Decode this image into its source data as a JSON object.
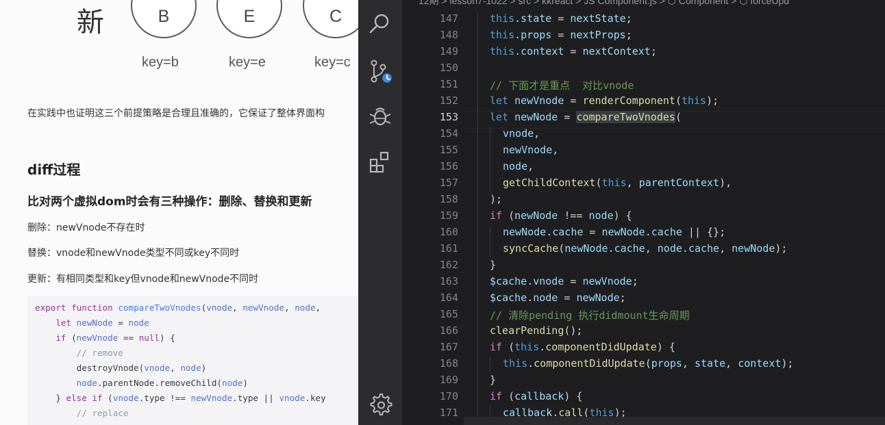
{
  "doc": {
    "new_char": "新",
    "nodes": [
      {
        "letter": "B",
        "key": "key=b"
      },
      {
        "letter": "E",
        "key": "key=e"
      },
      {
        "letter": "C",
        "key": "key=c"
      }
    ],
    "paragraph": "在实践中也证明这三个前提策略是合理且准确的，它保证了整体界面构",
    "heading": "diff过程",
    "subheading": "比对两个虚拟dom时会有三种操作：删除、替换和更新",
    "items": [
      "删除：newVnode不存在时",
      "替换：vnode和newVnode类型不同或key不同时",
      "更新：有相同类型和key但vnode和newVnode不同时"
    ],
    "code": {
      "l1a": "export",
      "l1b": " function ",
      "l1c": "compareTwoVnodes",
      "l1d": "(",
      "l1e": "vnode",
      "l1f": ", ",
      "l1g": "newVnode",
      "l1h": ", ",
      "l1i": "node",
      "l1j": ", ",
      "l2a": "    let ",
      "l2b": "newNode",
      "l2c": " = ",
      "l2d": "node",
      "l3a": "    if ",
      "l3b": "(",
      "l3c": "newVnode",
      "l3d": " == ",
      "l3e": "null",
      "l3f": ") {",
      "l4": "        // remove",
      "l5a": "        destroyVnode(",
      "l5b": "vnode",
      "l5c": ", ",
      "l5d": "node",
      "l5e": ")",
      "l6a": "        ",
      "l6b": "node",
      "l6c": ".parentNode.removeChild(",
      "l6d": "node",
      "l6e": ")",
      "l7a": "    } ",
      "l7b": "else if ",
      "l7c": "(",
      "l7d": "vnode",
      "l7e": ".type !== ",
      "l7f": "newVnode",
      "l7g": ".type || ",
      "l7h": "vnode",
      "l7i": ".key",
      "l8": "        // replace"
    }
  },
  "editor": {
    "breadcrumb": "12期  >  lesson7-1022  >  src  >  kkreact  >  JS Component.js  >  ⬡ Component  >  ⬡ forceUpd",
    "lines": [
      {
        "n": "147",
        "t": [
          "this",
          ".state",
          " = ",
          "nextState",
          ";"
        ]
      },
      {
        "n": "148",
        "t": [
          "this",
          ".props",
          " = ",
          "nextProps",
          ";"
        ]
      },
      {
        "n": "149",
        "t": [
          "this",
          ".context",
          " = ",
          "nextContext",
          ";"
        ]
      },
      {
        "n": "150"
      },
      {
        "n": "151",
        "t": [
          "// 下面才是重点  对比vnode"
        ]
      },
      {
        "n": "152",
        "t": [
          "let ",
          "newVnode",
          " = ",
          "renderComponent",
          "(",
          "this",
          ");"
        ]
      },
      {
        "n": "153",
        "t": [
          "let ",
          "newNode",
          " = ",
          "compareTwoVnodes",
          "("
        ]
      },
      {
        "n": "154",
        "t": [
          "vnode",
          ","
        ]
      },
      {
        "n": "155",
        "t": [
          "newVnode",
          ","
        ]
      },
      {
        "n": "156",
        "t": [
          "node",
          ","
        ]
      },
      {
        "n": "157",
        "t": [
          "getChildContext",
          "(",
          "this",
          ", ",
          "parentContext",
          "),"
        ]
      },
      {
        "n": "158",
        "t": [
          ");"
        ]
      },
      {
        "n": "159",
        "t": [
          "if ",
          "(",
          "newNode",
          " !== ",
          "node",
          ") {"
        ]
      },
      {
        "n": "160",
        "t": [
          "newNode",
          ".",
          "cache",
          " = ",
          "newNode",
          ".",
          "cache",
          " || {};"
        ]
      },
      {
        "n": "161",
        "t": [
          "syncCache",
          "(",
          "newNode",
          ".",
          "cache",
          ", ",
          "node",
          ".",
          "cache",
          ", ",
          "newNode",
          ");"
        ]
      },
      {
        "n": "162",
        "t": [
          "}"
        ]
      },
      {
        "n": "163",
        "t": [
          "$cache",
          ".",
          "vnode",
          " = ",
          "newVnode",
          ";"
        ]
      },
      {
        "n": "164",
        "t": [
          "$cache",
          ".",
          "node",
          " = ",
          "newNode",
          ";"
        ]
      },
      {
        "n": "165",
        "t": [
          "// 清除pending 执行didmount生命周期"
        ]
      },
      {
        "n": "166",
        "t": [
          "clearPending",
          "();"
        ]
      },
      {
        "n": "167",
        "t": [
          "if ",
          "(",
          "this",
          ".",
          "componentDidUpdate",
          ") {"
        ]
      },
      {
        "n": "168",
        "t": [
          "this",
          ".",
          "componentDidUpdate",
          "(",
          "props",
          ", ",
          "state",
          ", ",
          "context",
          ");"
        ]
      },
      {
        "n": "169",
        "t": [
          "}"
        ]
      },
      {
        "n": "170",
        "t": [
          "if ",
          "(",
          "callback",
          ") {"
        ]
      },
      {
        "n": "171",
        "t": [
          "callback",
          ".",
          "call",
          "(",
          "this",
          ");"
        ]
      }
    ]
  },
  "icons": [
    "search-icon",
    "source-control-icon",
    "debug-icon",
    "extensions-icon",
    "settings-gear-icon"
  ],
  "colors": {
    "activity_bg": "#2c2c2e",
    "editor_bg": "#1e1e20",
    "keyword": "#569cd6",
    "function": "#dcdcaa",
    "variable": "#9cdcfe",
    "comment": "#6a9955"
  }
}
